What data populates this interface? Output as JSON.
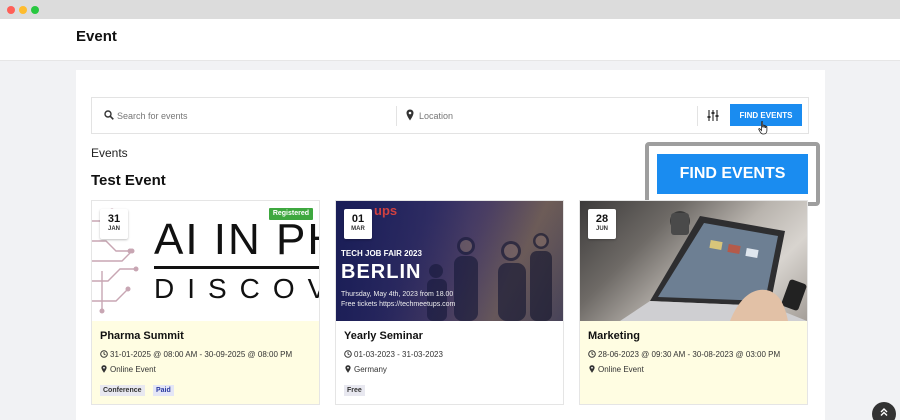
{
  "page": {
    "title": "Event"
  },
  "search": {
    "keyword_placeholder": "Search for events",
    "location_placeholder": "Location",
    "find_button_label": "FIND EVENTS"
  },
  "zoom_callout": {
    "find_button_label": "FIND EVENTS"
  },
  "sections": {
    "label": "Events",
    "heading": "Test Event"
  },
  "events": [
    {
      "day": "31",
      "month": "JAN",
      "badge": "Registered",
      "image_text_line1": "AI IN PHA",
      "image_text_line2": "DISCOV",
      "title": "Pharma Summit",
      "dates": "31-01-2025 @ 08:00 AM - 30-09-2025 @ 08:00 PM",
      "location": "Online Event",
      "tags": [
        "Conference",
        "Paid"
      ]
    },
    {
      "day": "01",
      "month": "MAR",
      "image_logo": "ups",
      "image_fair": "TECH JOB FAIR 2023",
      "image_city": "BERLIN",
      "image_info_1": "Thursday, May 4th, 2023 from 18.00",
      "image_info_2": "Free tickets https://techmeetups.com",
      "title": "Yearly Seminar",
      "dates": "01-03-2023 - 31-03-2023",
      "location": "Germany",
      "tags": [
        "Free"
      ]
    },
    {
      "day": "28",
      "month": "JUN",
      "title": "Marketing",
      "dates": "28-06-2023 @ 09:30 AM - 30-08-2023 @ 03:00 PM",
      "location": "Online Event",
      "tags": []
    }
  ],
  "colors": {
    "accent": "#1a8cf0",
    "registered": "#3ea83f",
    "highlight_card": "#fffde2"
  },
  "icons": {
    "search": "search-icon",
    "location": "map-pin-icon",
    "filter": "filter-sliders-icon",
    "clock": "clock-icon",
    "back_to_top": "double-chevron-up-icon"
  }
}
